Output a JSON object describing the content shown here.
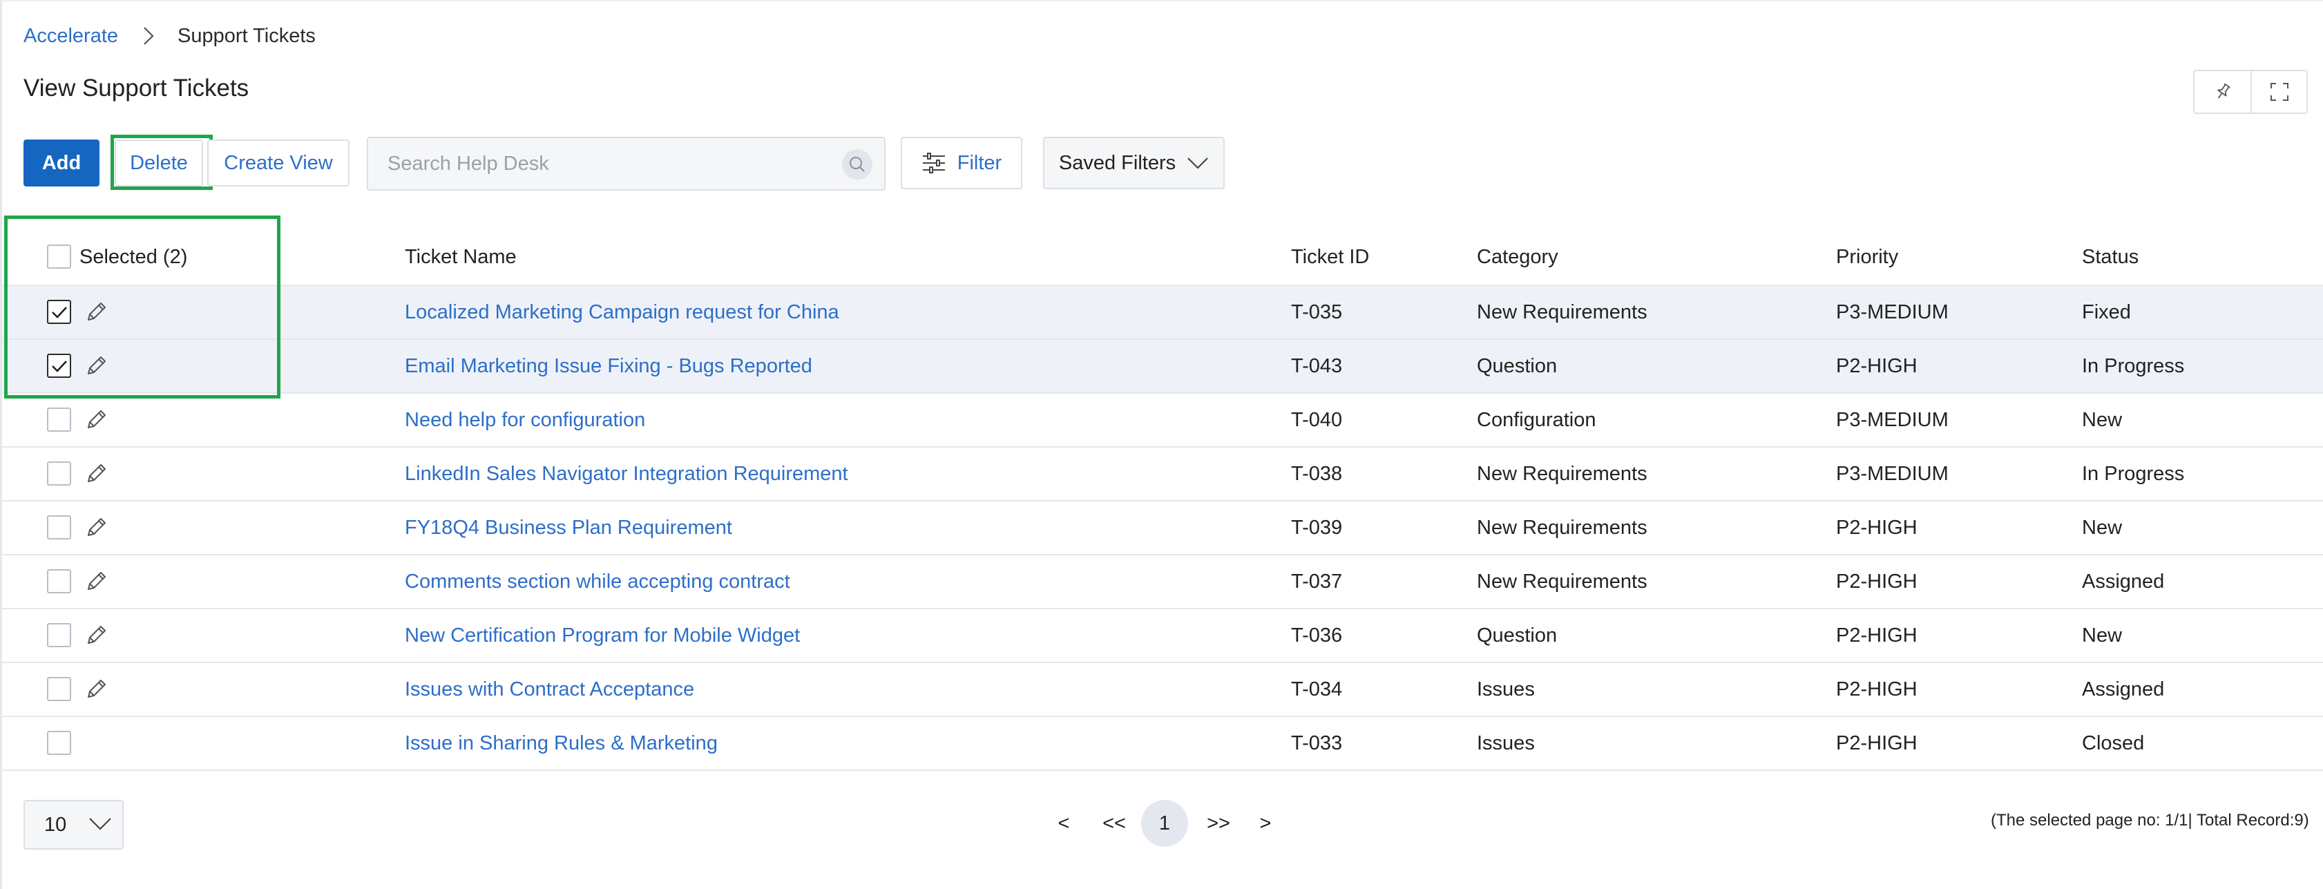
{
  "breadcrumb": {
    "root": "Accelerate",
    "current": "Support Tickets"
  },
  "page": {
    "title": "View Support Tickets"
  },
  "toolbar": {
    "add_label": "Add",
    "delete_label": "Delete",
    "create_view_label": "Create View",
    "search_placeholder": "Search Help Desk",
    "search_value": "",
    "filter_label": "Filter",
    "saved_filters_label": "Saved Filters"
  },
  "colors": {
    "primary": "#1566c0",
    "link": "#2d6ec8",
    "highlight": "#1fa64a",
    "selected_row": "#eef2f8"
  },
  "table": {
    "selected_label": "Selected (2)",
    "columns": [
      "Ticket Name",
      "Ticket ID",
      "Category",
      "Priority",
      "Status"
    ],
    "rows": [
      {
        "checked": true,
        "editable": true,
        "name": "Localized Marketing Campaign request for China",
        "id": "T-035",
        "category": "New Requirements",
        "priority": "P3-MEDIUM",
        "status": "Fixed"
      },
      {
        "checked": true,
        "editable": true,
        "name": "Email Marketing Issue Fixing - Bugs Reported",
        "id": "T-043",
        "category": "Question",
        "priority": "P2-HIGH",
        "status": "In Progress"
      },
      {
        "checked": false,
        "editable": true,
        "name": "Need help for configuration",
        "id": "T-040",
        "category": "Configuration",
        "priority": "P3-MEDIUM",
        "status": "New"
      },
      {
        "checked": false,
        "editable": true,
        "name": "LinkedIn Sales Navigator Integration Requirement",
        "id": "T-038",
        "category": "New Requirements",
        "priority": "P3-MEDIUM",
        "status": "In Progress"
      },
      {
        "checked": false,
        "editable": true,
        "name": "FY18Q4 Business Plan Requirement",
        "id": "T-039",
        "category": "New Requirements",
        "priority": "P2-HIGH",
        "status": "New"
      },
      {
        "checked": false,
        "editable": true,
        "name": "Comments section while accepting contract",
        "id": "T-037",
        "category": "New Requirements",
        "priority": "P2-HIGH",
        "status": "Assigned"
      },
      {
        "checked": false,
        "editable": true,
        "name": "New Certification Program for Mobile Widget",
        "id": "T-036",
        "category": "Question",
        "priority": "P2-HIGH",
        "status": "New"
      },
      {
        "checked": false,
        "editable": true,
        "name": "Issues with Contract Acceptance",
        "id": "T-034",
        "category": "Issues",
        "priority": "P2-HIGH",
        "status": "Assigned"
      },
      {
        "checked": false,
        "editable": false,
        "name": "Issue in Sharing Rules & Marketing",
        "id": "T-033",
        "category": "Issues",
        "priority": "P2-HIGH",
        "status": "Closed"
      }
    ]
  },
  "pagination": {
    "page_size": "10",
    "prev": "<",
    "first": "<<",
    "current": "1",
    "last": ">>",
    "next": ">",
    "summary": "(The selected page no: 1/1| Total Record:9)"
  }
}
